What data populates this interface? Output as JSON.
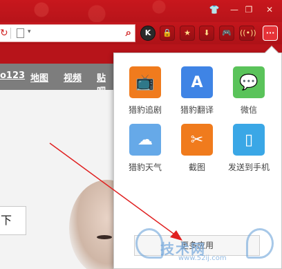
{
  "window": {
    "controls": {
      "skin": "👕",
      "minimize": "—",
      "restore": "❐",
      "close": "✕"
    }
  },
  "toolbar": {
    "reload_icon": "↻",
    "caret": "▾",
    "search_icon": "🔍",
    "buttons": [
      {
        "label": "K"
      },
      {
        "label": "🔒"
      },
      {
        "label": "★"
      },
      {
        "label": "⬇"
      },
      {
        "label": "🎮"
      },
      {
        "label": "((•))"
      },
      {
        "label": "···"
      }
    ]
  },
  "nav": {
    "items": [
      "o123",
      "地图",
      "视频",
      "贴吧"
    ]
  },
  "page": {
    "down_text": "下"
  },
  "popup": {
    "apps": [
      {
        "label": "猎豹追剧",
        "glyph": "📺",
        "color": "#f07b1d"
      },
      {
        "label": "猎豹翻译",
        "glyph": "A",
        "color": "#3f84e5"
      },
      {
        "label": "微信",
        "glyph": "💬",
        "color": "#5ac35a"
      },
      {
        "label": "猎豹天气",
        "glyph": "☁",
        "color": "#66a9e8"
      },
      {
        "label": "截图",
        "glyph": "✂",
        "color": "#f07b1d"
      },
      {
        "label": "发送到手机",
        "glyph": "▯",
        "color": "#3aa7e6"
      }
    ],
    "button_label": "更多应用"
  },
  "watermark": {
    "text": "技术网",
    "url": "www.52ij.com"
  },
  "colors": {
    "brand_red": "#c3161c",
    "annotation_red": "#e02020"
  }
}
